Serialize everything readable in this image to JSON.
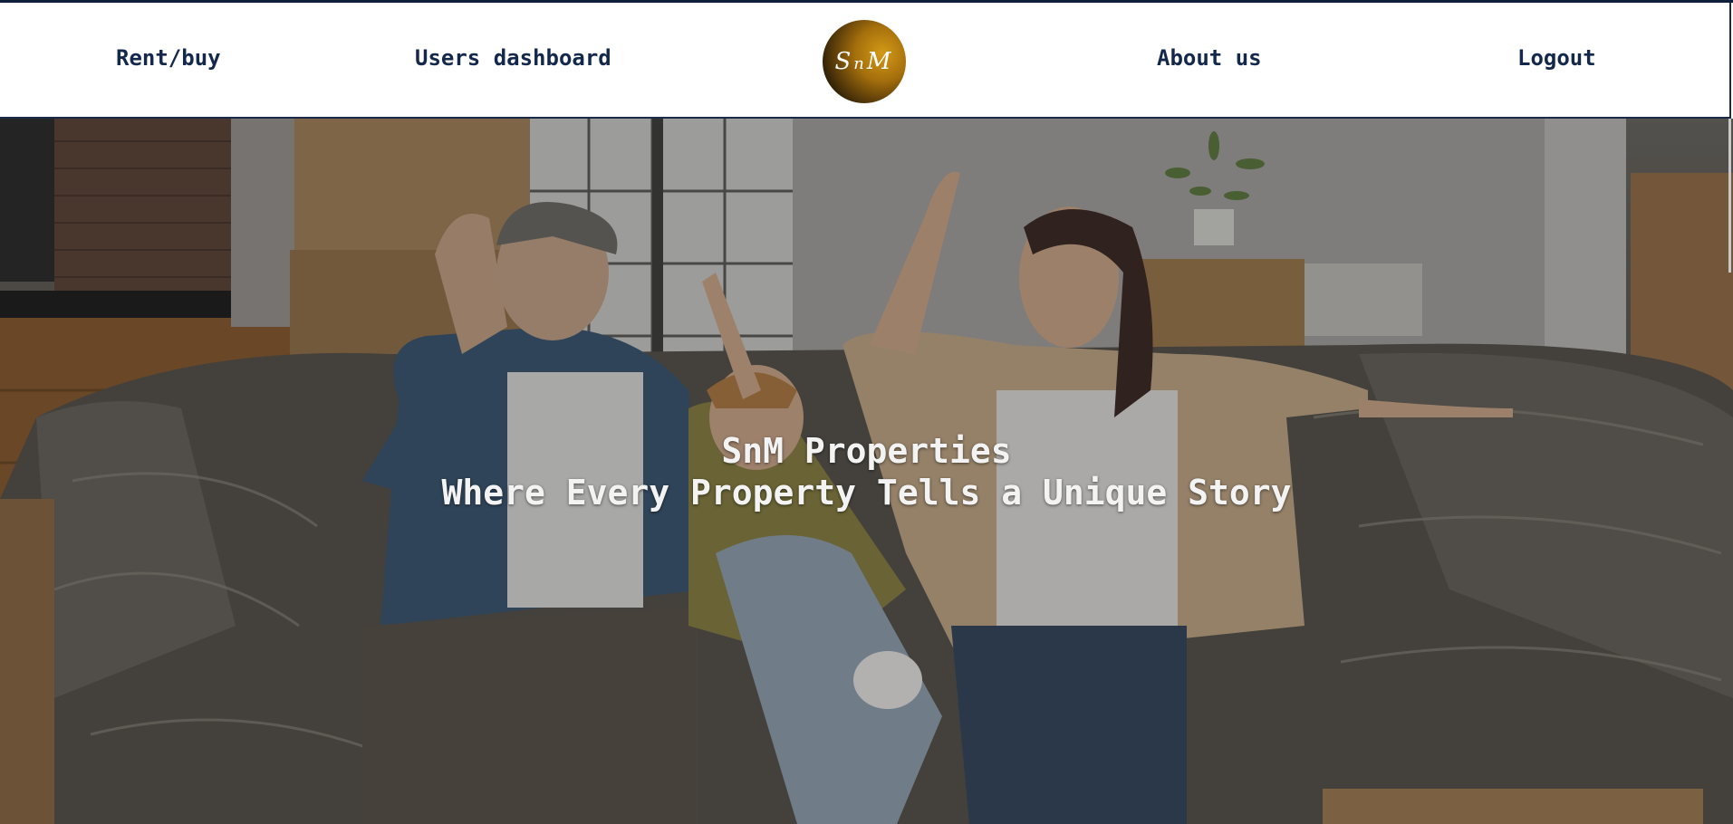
{
  "nav": {
    "rent_buy": "Rent/buy",
    "users_dashboard": "Users dashboard",
    "about_us": "About us",
    "logout": "Logout"
  },
  "logo": {
    "letter_left": "S",
    "letter_mid": "n",
    "letter_right": "M",
    "icon": "brand-logo"
  },
  "hero": {
    "title": "SnM Properties",
    "tagline": "Where Every Property Tells a Unique Story"
  },
  "colors": {
    "nav_text": "#13284a",
    "nav_border": "#1a2a48",
    "logo_gold": "#b57c10",
    "hero_text": "#f3f3f3"
  }
}
